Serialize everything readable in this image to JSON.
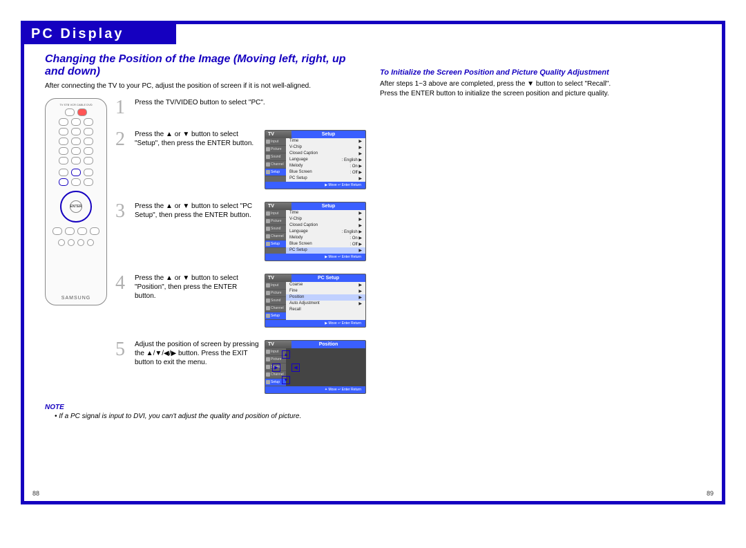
{
  "header": "PC Display",
  "subheading": "Changing the Position of the Image (Moving left, right, up and down)",
  "intro": "After connecting the TV to your PC, adjust the position of screen if it is not well-aligned.",
  "remote_brand": "SAMSUNG",
  "steps": [
    {
      "num": "1",
      "text": "Press the TV/VIDEO button to select \"PC\"."
    },
    {
      "num": "2",
      "text": "Press the ▲ or ▼ button to select \"Setup\", then press the ENTER button."
    },
    {
      "num": "3",
      "text": "Press the ▲ or ▼ button to select \"PC Setup\", then press the ENTER button."
    },
    {
      "num": "4",
      "text": "Press the ▲ or ▼ button to select \"Position\", then press the ENTER button."
    },
    {
      "num": "5",
      "text": "Adjust the position of screen by pressing the ▲/▼/◀/▶ button. Press the EXIT button to exit the menu."
    }
  ],
  "osd_tv": "TV",
  "osd_sidebar": [
    "Input",
    "Picture",
    "Sound",
    "Channel",
    "Setup"
  ],
  "osd_titles": {
    "setup": "Setup",
    "pcsetup": "PC Setup",
    "position": "Position"
  },
  "menu_setup": [
    {
      "k": "Time",
      "v": "▶"
    },
    {
      "k": "V-Chip",
      "v": "▶"
    },
    {
      "k": "Closed Caption",
      "v": "▶"
    },
    {
      "k": "Language",
      "v": ": English   ▶"
    },
    {
      "k": "Melody",
      "v": ": On   ▶"
    },
    {
      "k": "Blue Screen",
      "v": ": Off   ▶"
    },
    {
      "k": "PC Setup",
      "v": "▶"
    }
  ],
  "menu_pcsetup": [
    {
      "k": "Coarse",
      "v": "▶"
    },
    {
      "k": "Fine",
      "v": "▶"
    },
    {
      "k": "Position",
      "v": "▶"
    },
    {
      "k": "Auto Adjustment",
      "v": "▶"
    },
    {
      "k": "Recall",
      "v": ""
    }
  ],
  "osd_foot1": "▶ Move   ↵ Enter   Return",
  "osd_foot2": "✦ Move   ↵ Enter   Return",
  "note_label": "NOTE",
  "note_text": "• If a PC signal is input to DVI, you can't adjust the quality and position of picture.",
  "right_heading": "To Initialize the Screen Position and Picture Quality Adjustment",
  "right_body_1": "After steps 1~3 above are completed, press the ▼ button to select \"Recall\".",
  "right_body_2": "Press the ENTER button to initialize the screen position and picture quality.",
  "page_left": "88",
  "page_right": "89"
}
